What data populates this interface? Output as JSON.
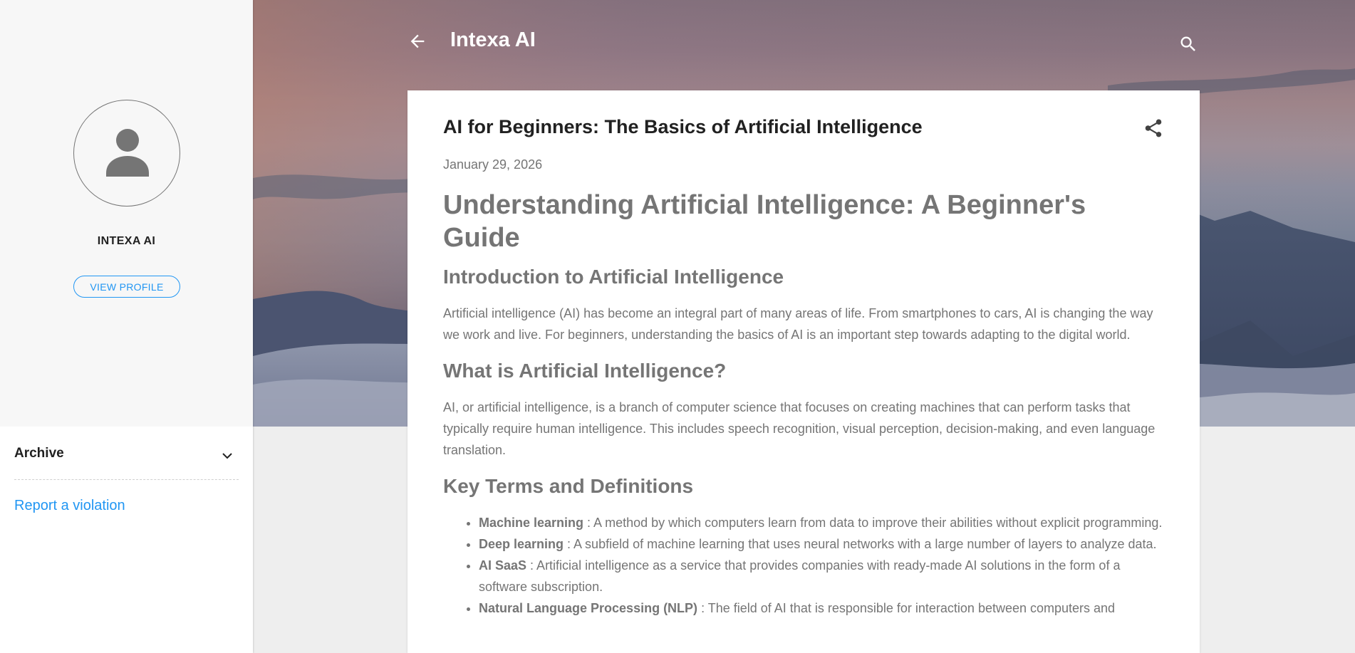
{
  "sidebar": {
    "profile_name": "INTEXA AI",
    "view_profile_label": "VIEW PROFILE",
    "archive_label": "Archive",
    "report_label": "Report a violation"
  },
  "header": {
    "blog_title": "Intexa AI"
  },
  "post": {
    "title": "AI for Beginners: The Basics of Artificial Intelligence",
    "date": "January 29, 2026",
    "heading": "Understanding Artificial Intelligence: A Beginner's Guide",
    "section1_title": "Introduction to Artificial Intelligence",
    "section1_text": "Artificial intelligence (AI) has become an integral part of many areas of life. From smartphones to cars, AI is changing the way we work and live. For beginners, understanding the basics of AI is an important step towards adapting to the digital world.",
    "section2_title": "What is Artificial Intelligence?",
    "section2_text": "AI, or artificial intelligence, is a branch of computer science that focuses on creating machines that can perform tasks that typically require human intelligence. This includes speech recognition, visual perception, decision-making, and even language translation.",
    "section3_title": "Key Terms and Definitions",
    "terms": [
      {
        "term": "Machine learning",
        "definition": " : A method by which computers learn from data to improve their abilities without explicit programming."
      },
      {
        "term": "Deep learning",
        "definition": " : A subfield of machine learning that uses neural networks with a large number of layers to analyze data."
      },
      {
        "term": "AI SaaS",
        "definition": " : Artificial intelligence as a service that provides companies with ready-made AI solutions in the form of a software subscription."
      },
      {
        "term": "Natural Language Processing (NLP)",
        "definition": " : The field of AI that is responsible for interaction between computers and"
      }
    ]
  },
  "colors": {
    "accent": "#2196f3",
    "sidebar_bg": "#f7f7f7",
    "page_bg": "#eeeeee",
    "body_text": "#757575",
    "title_text": "#212121"
  },
  "icons": {
    "back": "arrow-back-icon",
    "search": "search-icon",
    "share": "share-icon",
    "avatar": "person-icon",
    "archive_toggle": "chevron-down-icon"
  }
}
